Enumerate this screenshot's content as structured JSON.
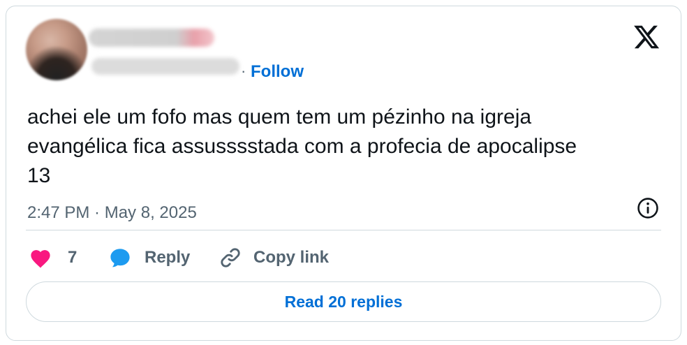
{
  "header": {
    "separator": "·",
    "follow_label": "Follow"
  },
  "tweet": {
    "text": "achei ele um fofo mas quem tem um pézinho na igreja\nevangélica fica assusssstada com a profecia de apocalipse\n13",
    "timestamp": "2:47 PM · May 8, 2025"
  },
  "actions": {
    "like_count": "7",
    "reply_label": "Reply",
    "copy_label": "Copy link"
  },
  "footer": {
    "read_replies_label": "Read 20 replies"
  },
  "icons": {
    "logo": "x-logo-icon",
    "info": "info-icon",
    "like": "heart-icon",
    "reply": "speech-bubble-icon",
    "copy": "link-icon"
  },
  "colors": {
    "accent": "#006fd6",
    "like": "#f91880",
    "reply": "#1d9bf0",
    "muted": "#536471",
    "border": "#cfd9de"
  }
}
